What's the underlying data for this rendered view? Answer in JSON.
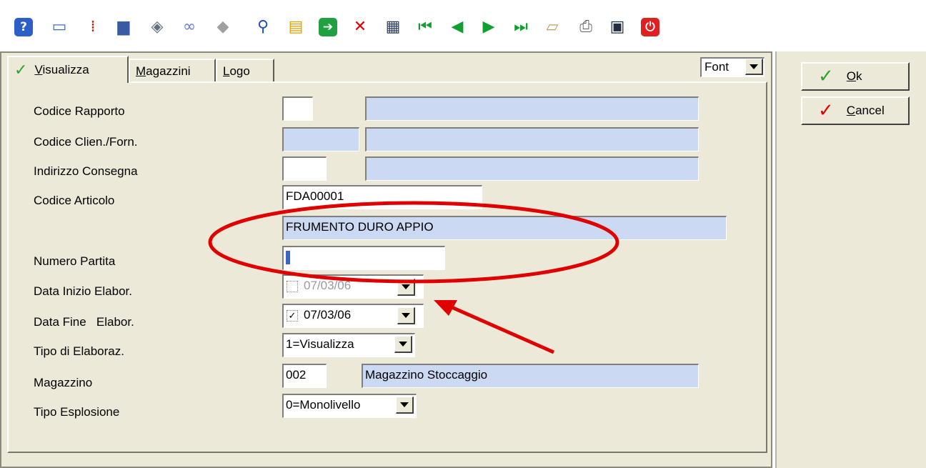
{
  "toolbar": {
    "icons": [
      {
        "name": "help-icon",
        "glyph": "?",
        "color": "#ffffff",
        "bg": "#2c5fc7"
      },
      {
        "name": "chat-icon",
        "glyph": "▭",
        "color": "#3c6cc8"
      },
      {
        "name": "cursor-icon",
        "glyph": "⁞",
        "color": "#d02000"
      },
      {
        "name": "monitor-icon",
        "glyph": "▆",
        "color": "#3a5aa8"
      },
      {
        "name": "printer-setup-icon",
        "glyph": "◈",
        "color": "#607080"
      },
      {
        "name": "link-icon",
        "glyph": "∞",
        "color": "#6a7ad0"
      },
      {
        "name": "diamond-icon",
        "glyph": "◆",
        "color": "#a0a0a0"
      },
      {
        "name": "search-icon",
        "glyph": "⚲",
        "color": "#2050c0"
      },
      {
        "name": "folder-icon",
        "glyph": "▤",
        "color": "#e0a000"
      },
      {
        "name": "enter-icon",
        "glyph": "➔",
        "color": "#ffffff",
        "bg": "#20a040"
      },
      {
        "name": "delete-icon",
        "glyph": "✕",
        "color": "#e00000"
      },
      {
        "name": "calculator-icon",
        "glyph": "▦",
        "color": "#304060"
      },
      {
        "name": "first-record-icon",
        "glyph": "⏮",
        "color": "#10a030"
      },
      {
        "name": "previous-record-icon",
        "glyph": "◀",
        "color": "#10a030"
      },
      {
        "name": "next-record-icon",
        "glyph": "▶",
        "color": "#10a030"
      },
      {
        "name": "last-record-icon",
        "glyph": "⏭",
        "color": "#10a030"
      },
      {
        "name": "book-icon",
        "glyph": "▱",
        "color": "#c0a060"
      },
      {
        "name": "print-icon",
        "glyph": "⎙",
        "color": "#606060"
      },
      {
        "name": "report-icon",
        "glyph": "▣",
        "color": "#203040"
      },
      {
        "name": "exit-icon",
        "glyph": "⏻",
        "color": "#ffffff",
        "bg": "#e02020"
      }
    ]
  },
  "tabs": [
    {
      "label": "Visualizza",
      "accel": "V",
      "rest": "isualizza",
      "active": true
    },
    {
      "label": "Magazzini",
      "accel": "M",
      "rest": "agazzini",
      "active": false
    },
    {
      "label": "Logo",
      "accel": "L",
      "rest": "ogo",
      "active": false
    }
  ],
  "font_combo": {
    "value": "Font"
  },
  "form": {
    "codice_rapporto": {
      "label": "Codice Rapporto",
      "code": "",
      "desc": ""
    },
    "codice_clien_forn": {
      "label": "Codice Clien./Forn.",
      "code": "",
      "desc": ""
    },
    "indirizzo_consegna": {
      "label": "Indirizzo Consegna",
      "code": "",
      "desc": ""
    },
    "codice_articolo": {
      "label": "Codice Articolo",
      "code": "FDA00001",
      "desc": "FRUMENTO DURO APPIO"
    },
    "numero_partita": {
      "label": "Numero Partita",
      "value": ""
    },
    "data_inizio": {
      "label": "Data Inizio Elabor.",
      "value": "07/03/06",
      "checked": false
    },
    "data_fine": {
      "label": "Data Fine   Elabor.",
      "value": "07/03/06",
      "checked": true
    },
    "tipo_elaboraz": {
      "label": "Tipo di Elaboraz.",
      "value": "1=Visualizza"
    },
    "magazzino": {
      "label": "Magazzino",
      "code": "002",
      "desc": "Magazzino Stoccaggio"
    },
    "tipo_esplosione": {
      "label": "Tipo Esplosione",
      "value": "0=Monolivello"
    }
  },
  "buttons": {
    "ok": {
      "accel": "O",
      "rest": "k",
      "check_color": "#2aa52a"
    },
    "cancel": {
      "accel": "C",
      "rest": "ancel",
      "check_color": "#e00000"
    }
  },
  "annotation_color": "#e00000"
}
